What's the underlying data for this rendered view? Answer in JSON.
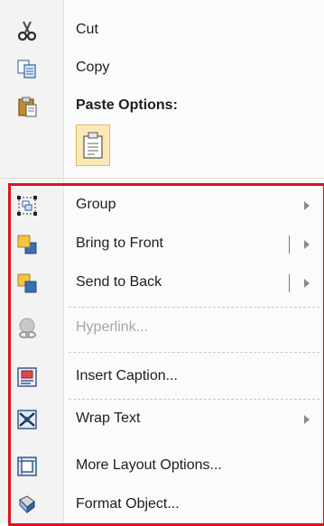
{
  "menu": {
    "cut": {
      "label": "Cut",
      "mnemonic_char": "t",
      "icon": "scissors-icon"
    },
    "copy": {
      "label": "Copy",
      "icon": "copy-icon"
    },
    "paste_options": {
      "label": "Paste Options:",
      "icon": "clipboard-icon"
    },
    "paste_keep_text": {
      "icon": "paste-keep-text-icon"
    },
    "group": {
      "label": "Group",
      "icon": "group-icon"
    },
    "bring_to_front": {
      "label": "Bring to Front",
      "icon": "bring-to-front-icon"
    },
    "send_to_back": {
      "label": "Send to Back",
      "icon": "send-to-back-icon"
    },
    "hyperlink": {
      "label": "Hyperlink...",
      "icon": "hyperlink-icon",
      "disabled": true
    },
    "insert_caption": {
      "label": "Insert Caption...",
      "icon": "insert-caption-icon"
    },
    "wrap_text": {
      "label": "Wrap Text",
      "icon": "wrap-text-icon"
    },
    "more_layout": {
      "label": "More Layout Options...",
      "icon": "layout-options-icon"
    },
    "format_object": {
      "label": "Format Object...",
      "icon": "format-object-icon"
    }
  },
  "colors": {
    "highlight_frame": "#e0121a",
    "gutter": "#f3f3f3",
    "paste_highlight": "#fde9b5"
  }
}
